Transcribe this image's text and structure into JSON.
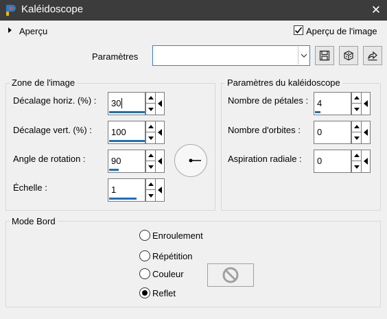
{
  "window": {
    "title": "Kaléidoscope",
    "close_glyph": "✕",
    "app_icon": "paintshop-logo-icon"
  },
  "preview": {
    "collapse_label": "Aperçu",
    "checkbox_label": "Aperçu de l'image",
    "checked": true
  },
  "presets": {
    "label": "Paramètres",
    "value": "",
    "buttons": [
      "save-preset-icon",
      "randomize-dice-icon",
      "reset-icon"
    ]
  },
  "image_area": {
    "title": "Zone de l'image",
    "fields": [
      {
        "label": "Décalage horiz. (%) :",
        "value": "30"
      },
      {
        "label": "Décalage vert. (%) :",
        "value": "100"
      },
      {
        "label": "Angle de rotation :",
        "value": "90"
      },
      {
        "label": "Échelle :",
        "value": "1"
      }
    ]
  },
  "kaleidoscope": {
    "title": "Paramètres du kaléidoscope",
    "fields": [
      {
        "label": "Nombre de pétales :",
        "value": "4"
      },
      {
        "label": "Nombre d'orbites :",
        "value": "0"
      },
      {
        "label": "Aspiration radiale :",
        "value": "0"
      }
    ]
  },
  "edge_mode": {
    "title": "Mode Bord",
    "options": [
      {
        "label": "Enroulement",
        "selected": false
      },
      {
        "label": "Répétition",
        "selected": false
      },
      {
        "label": "Couleur",
        "selected": false
      },
      {
        "label": "Reflet",
        "selected": true
      }
    ],
    "color_swatch_icon": "no-color-icon"
  },
  "colors": {
    "titlebar": "#3c3c3c",
    "accent": "#1a6fc4",
    "background": "#f0f0f0"
  }
}
